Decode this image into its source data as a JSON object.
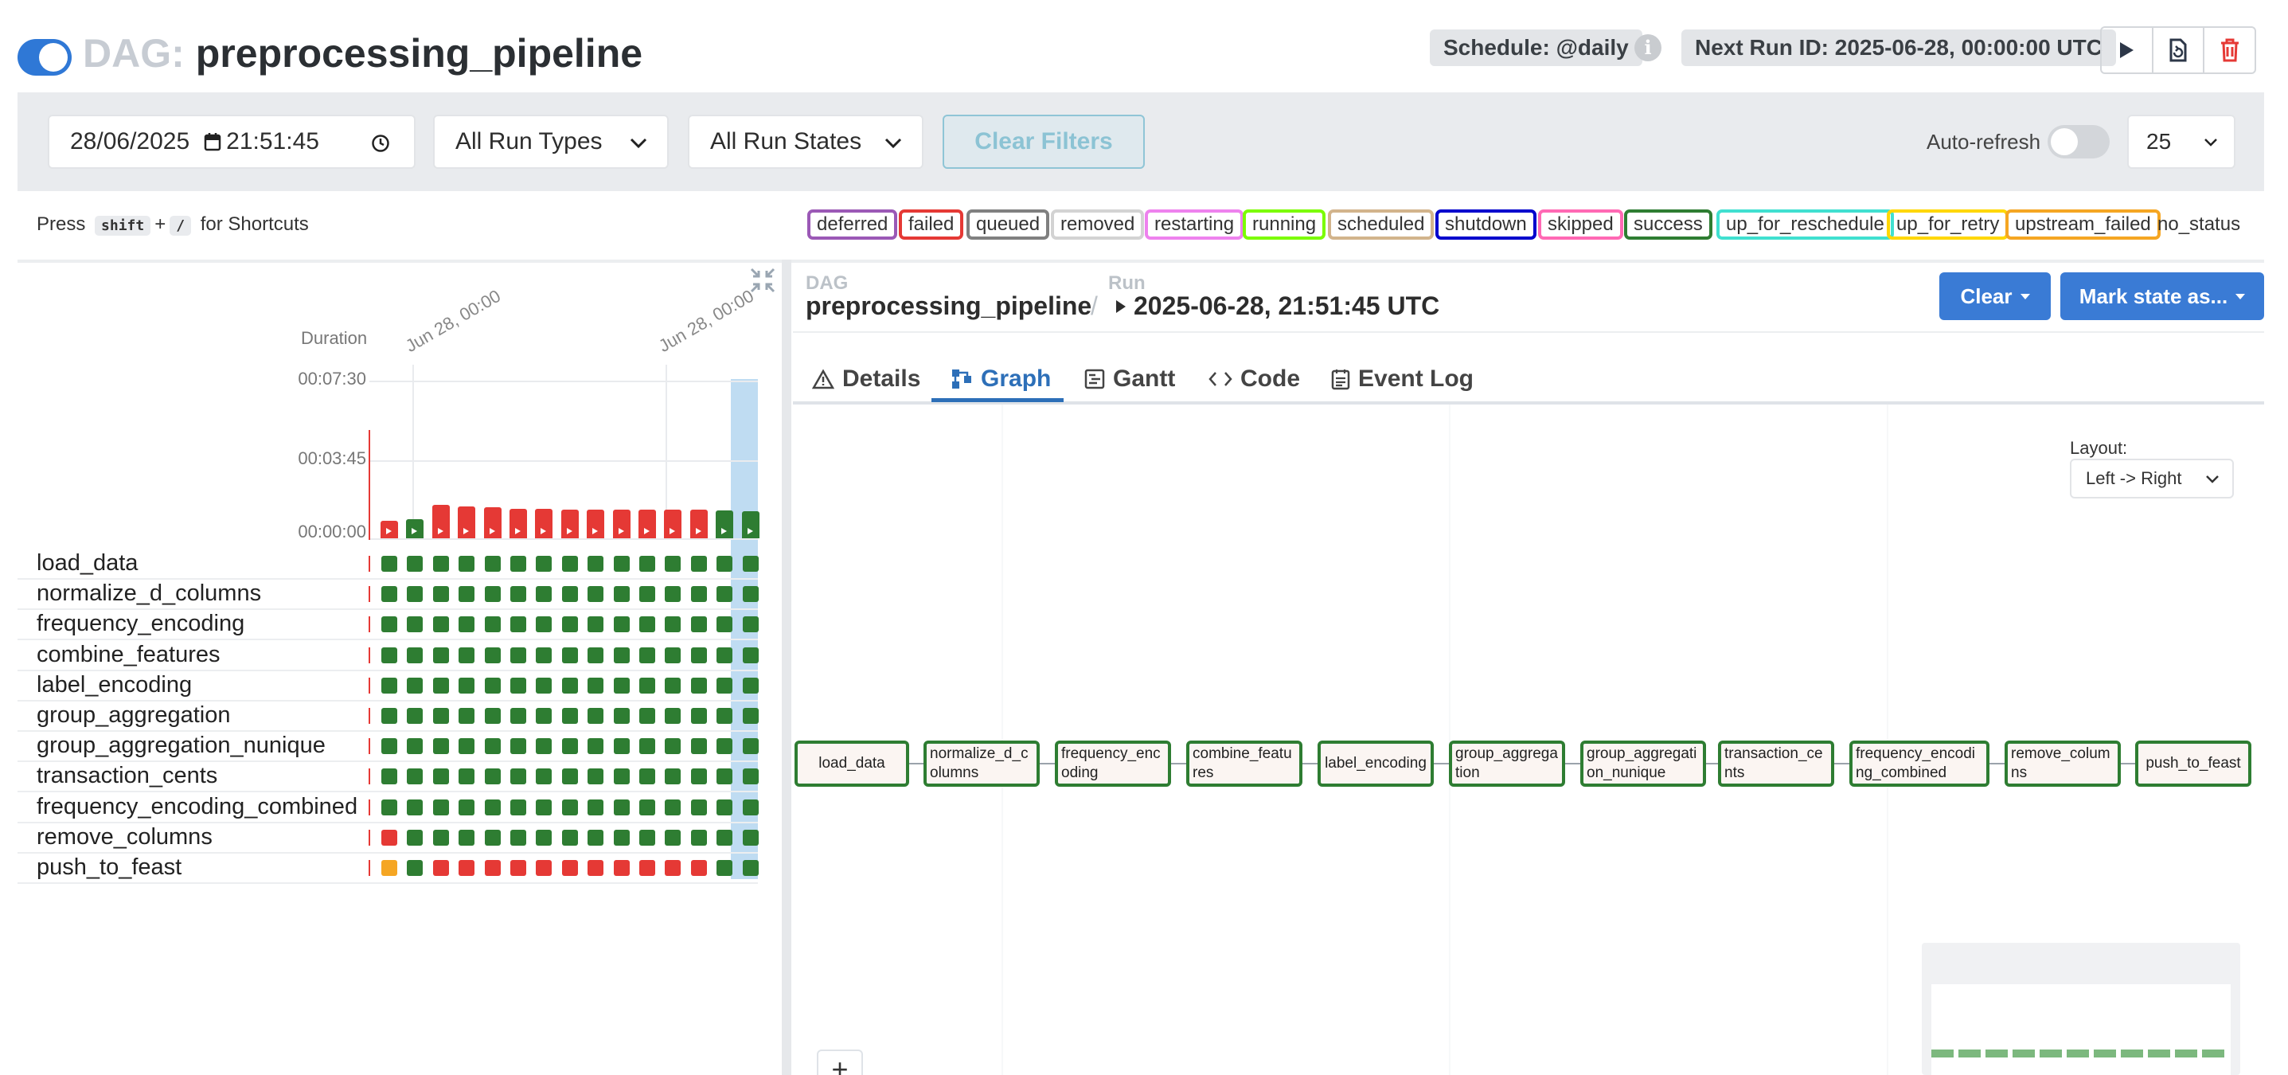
{
  "header": {
    "dag_prefix": "DAG:",
    "dag_name": "preprocessing_pipeline",
    "schedule": "Schedule: @daily",
    "next_run": "Next Run ID: 2025-06-28, 00:00:00 UTC",
    "info_glyph": "i"
  },
  "filters": {
    "date": "28/06/2025",
    "time": "21:51:45",
    "run_types": "All Run Types",
    "run_states": "All Run States",
    "clear_filters": "Clear Filters",
    "auto_refresh": "Auto-refresh",
    "page_size": "25"
  },
  "shortcut": {
    "press": "Press",
    "key1": "shift",
    "plus": "+",
    "key2": "/",
    "suffix": "for Shortcuts"
  },
  "legend": [
    {
      "label": "deferred",
      "color": "#9b59b6"
    },
    {
      "label": "failed",
      "color": "#e53935"
    },
    {
      "label": "queued",
      "color": "#808080"
    },
    {
      "label": "removed",
      "color": "#d3d3d3"
    },
    {
      "label": "restarting",
      "color": "#ee82ee"
    },
    {
      "label": "running",
      "color": "#7cfc00"
    },
    {
      "label": "scheduled",
      "color": "#d2b48c"
    },
    {
      "label": "shutdown",
      "color": "#0000cd"
    },
    {
      "label": "skipped",
      "color": "#ff69b4"
    },
    {
      "label": "success",
      "color": "#2e7d32"
    },
    {
      "label": "up_for_reschedule",
      "color": "#40e0d0"
    },
    {
      "label": "up_for_retry",
      "color": "#ffd700"
    },
    {
      "label": "upstream_failed",
      "color": "#f5a623"
    },
    {
      "label": "no_status",
      "color": ""
    }
  ],
  "grid": {
    "duration_label": "Duration",
    "date_labels": [
      "Jun 28, 00:00",
      "Jun 28, 00:00"
    ],
    "y_ticks": [
      "00:07:30",
      "00:03:45",
      "00:00:00"
    ],
    "run_states": [
      "failed",
      "success",
      "failed",
      "failed",
      "failed",
      "failed",
      "failed",
      "failed",
      "failed",
      "failed",
      "failed",
      "failed",
      "failed",
      "success",
      "success"
    ],
    "run_durations_sec": [
      50,
      55,
      95,
      90,
      88,
      84,
      84,
      82,
      82,
      82,
      82,
      82,
      82,
      80,
      78
    ],
    "y_max_sec": 450,
    "tasks": [
      {
        "name": "load_data",
        "states": [
          "success",
          "success",
          "success",
          "success",
          "success",
          "success",
          "success",
          "success",
          "success",
          "success",
          "success",
          "success",
          "success",
          "success",
          "success"
        ]
      },
      {
        "name": "normalize_d_columns",
        "states": [
          "success",
          "success",
          "success",
          "success",
          "success",
          "success",
          "success",
          "success",
          "success",
          "success",
          "success",
          "success",
          "success",
          "success",
          "success"
        ]
      },
      {
        "name": "frequency_encoding",
        "states": [
          "success",
          "success",
          "success",
          "success",
          "success",
          "success",
          "success",
          "success",
          "success",
          "success",
          "success",
          "success",
          "success",
          "success",
          "success"
        ]
      },
      {
        "name": "combine_features",
        "states": [
          "success",
          "success",
          "success",
          "success",
          "success",
          "success",
          "success",
          "success",
          "success",
          "success",
          "success",
          "success",
          "success",
          "success",
          "success"
        ]
      },
      {
        "name": "label_encoding",
        "states": [
          "success",
          "success",
          "success",
          "success",
          "success",
          "success",
          "success",
          "success",
          "success",
          "success",
          "success",
          "success",
          "success",
          "success",
          "success"
        ]
      },
      {
        "name": "group_aggregation",
        "states": [
          "success",
          "success",
          "success",
          "success",
          "success",
          "success",
          "success",
          "success",
          "success",
          "success",
          "success",
          "success",
          "success",
          "success",
          "success"
        ]
      },
      {
        "name": "group_aggregation_nunique",
        "states": [
          "success",
          "success",
          "success",
          "success",
          "success",
          "success",
          "success",
          "success",
          "success",
          "success",
          "success",
          "success",
          "success",
          "success",
          "success"
        ]
      },
      {
        "name": "transaction_cents",
        "states": [
          "success",
          "success",
          "success",
          "success",
          "success",
          "success",
          "success",
          "success",
          "success",
          "success",
          "success",
          "success",
          "success",
          "success",
          "success"
        ]
      },
      {
        "name": "frequency_encoding_combined",
        "states": [
          "success",
          "success",
          "success",
          "success",
          "success",
          "success",
          "success",
          "success",
          "success",
          "success",
          "success",
          "success",
          "success",
          "success",
          "success"
        ]
      },
      {
        "name": "remove_columns",
        "states": [
          "failed",
          "success",
          "success",
          "success",
          "success",
          "success",
          "success",
          "success",
          "success",
          "success",
          "success",
          "success",
          "success",
          "success",
          "success"
        ]
      },
      {
        "name": "push_to_feast",
        "states": [
          "upstream_failed",
          "success",
          "failed",
          "failed",
          "failed",
          "failed",
          "failed",
          "failed",
          "failed",
          "failed",
          "failed",
          "failed",
          "failed",
          "success",
          "success"
        ]
      }
    ]
  },
  "run_detail": {
    "dag_label": "DAG",
    "dag_name": "preprocessing_pipeline",
    "separator": "/",
    "run_label": "Run",
    "run_id": "2025-06-28, 21:51:45 UTC",
    "clear_btn": "Clear",
    "mark_btn": "Mark state as..."
  },
  "tabs": [
    {
      "label": "Details",
      "icon": "warning-icon"
    },
    {
      "label": "Graph",
      "icon": "graph-icon"
    },
    {
      "label": "Gantt",
      "icon": "gantt-icon"
    },
    {
      "label": "Code",
      "icon": "code-icon"
    },
    {
      "label": "Event Log",
      "icon": "event-log-icon"
    }
  ],
  "graph": {
    "layout_label": "Layout:",
    "layout_value": "Left -> Right",
    "zoom_in": "+",
    "nodes": [
      "load_data",
      "normalize_d_columns",
      "frequency_encoding",
      "combine_features",
      "label_encoding",
      "group_aggregation",
      "group_aggregation_nunique",
      "transaction_cents",
      "frequency_encoding_combined",
      "remove_columns",
      "push_to_feast"
    ]
  },
  "colors": {
    "success": "#2e7d32",
    "failed": "#e53935",
    "upstream_failed": "#f5a623",
    "accent": "#3a7bd5"
  }
}
